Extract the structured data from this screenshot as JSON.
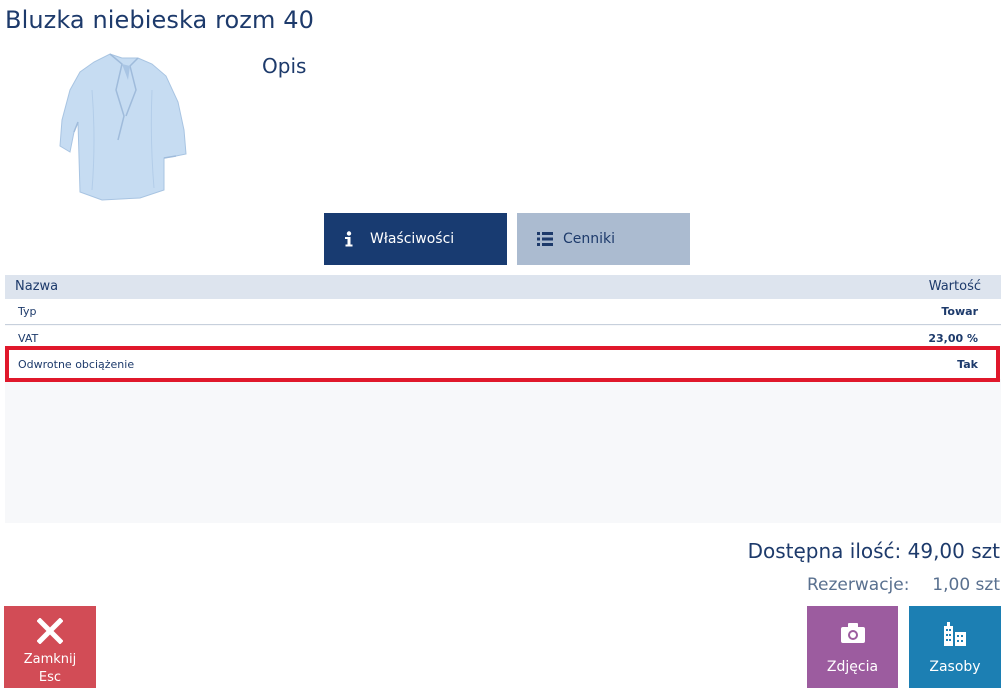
{
  "product": {
    "title": "Bluzka niebieska rozm 40",
    "description_label": "Opis"
  },
  "tabs": [
    {
      "label": "Właściwości",
      "icon": "info-icon",
      "active": true
    },
    {
      "label": "Cenniki",
      "icon": "list-icon",
      "active": false
    }
  ],
  "grid": {
    "headers": {
      "name": "Nazwa",
      "value": "Wartość"
    },
    "rows": [
      {
        "name": "Typ",
        "value": "Towar"
      },
      {
        "name": "VAT",
        "value": "23,00 %"
      },
      {
        "name": "Odwrotne obciążenie",
        "value": "Tak",
        "highlighted": true
      }
    ]
  },
  "stock": {
    "available": "Dostępna ilość: 49,00 szt",
    "reservations_label": "Rezerwacje:",
    "reservations_value": "1,00 szt"
  },
  "buttons": {
    "close_line1": "Zamknij",
    "close_line2": "Esc",
    "photos": "Zdjęcia",
    "resources": "Zasoby"
  },
  "colors": {
    "primary": "#183b71",
    "tab_inactive": "#abbbd0",
    "highlight": "#e0182b",
    "close": "#d24c56",
    "photos": "#9c5c9f",
    "resources": "#1c7fb3"
  }
}
